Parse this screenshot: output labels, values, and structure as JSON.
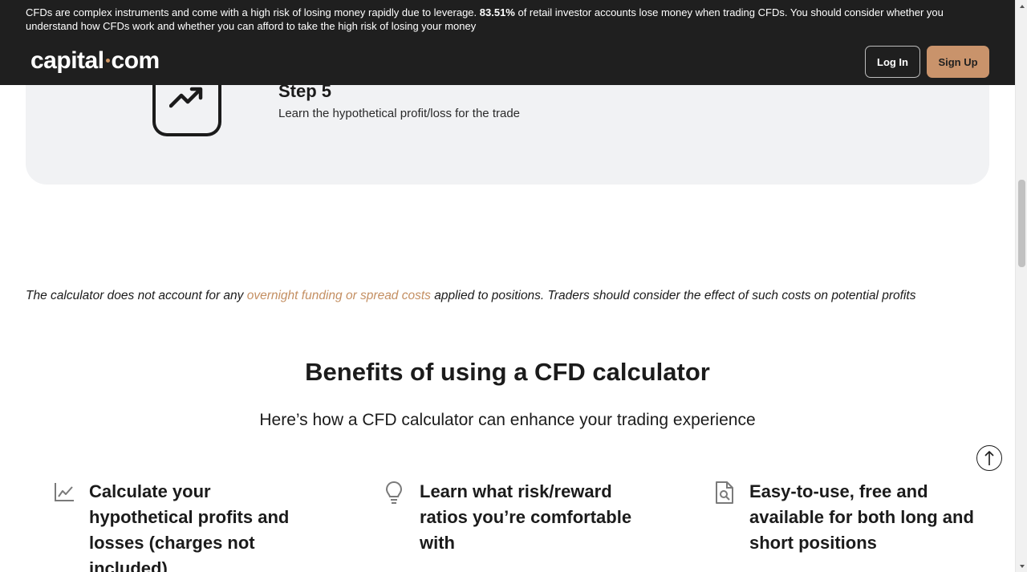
{
  "header": {
    "risk_prefix": "CFDs are complex instruments and come with a high risk of losing money rapidly due to leverage. ",
    "risk_percent": "83.51%",
    "risk_suffix": " of retail investor accounts lose money when trading CFDs. You should consider whether you understand how CFDs work and whether you can afford to take the high risk of losing your money",
    "logo_left": "capital",
    "logo_right": "com",
    "login_label": "Log In",
    "signup_label": "Sign Up"
  },
  "step": {
    "icon": "trending-up-icon",
    "title": "Step 5",
    "text": "Learn the hypothetical profit/loss for the trade"
  },
  "disclaimer": {
    "prefix": "The calculator does not account for any ",
    "link": "overnight funding or spread costs",
    "suffix": " applied to positions. Traders should consider the effect of such costs on potential profits"
  },
  "benefits": {
    "title": "Benefits of using a CFD calculator",
    "subtitle": "Here’s how a CFD calculator can enhance your trading experience",
    "items": [
      {
        "icon": "line-chart-icon",
        "text": "Calculate your hypothetical profits and losses (charges not included)"
      },
      {
        "icon": "lightbulb-icon",
        "text": "Learn what risk/reward ratios you’re comfortable with"
      },
      {
        "icon": "document-search-icon",
        "text": "Easy-to-use, free and available for both long and short positions"
      }
    ]
  },
  "colors": {
    "header_bg": "#1f1f1f",
    "accent": "#c9936b",
    "link": "#c48f62",
    "panel_bg": "#f1f2f4"
  }
}
